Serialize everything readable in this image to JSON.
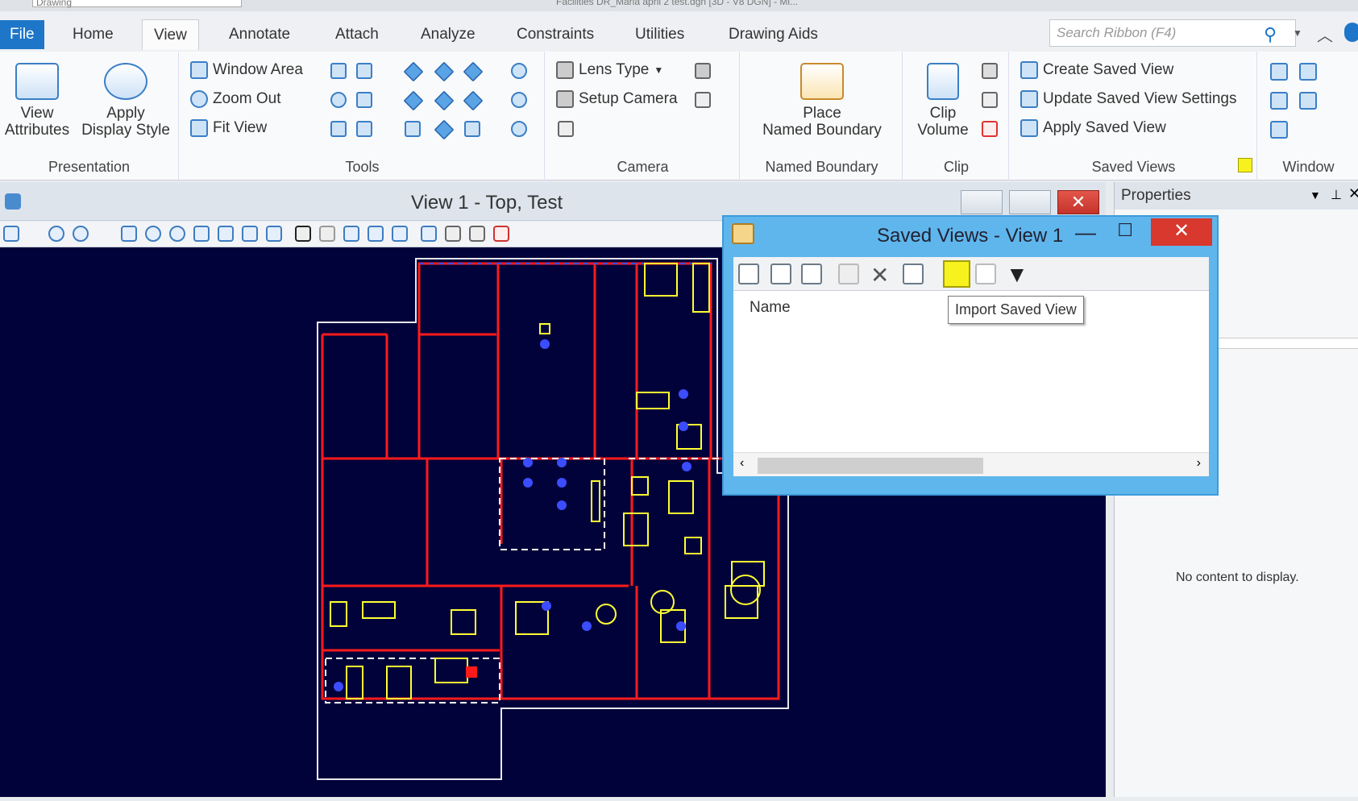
{
  "app": {
    "workspace": "Drawing",
    "title": "Facilities DR_Maria april 2 test.dgn [3D - V8 DGN] - Mi..."
  },
  "tabs": [
    "File",
    "Home",
    "View",
    "Annotate",
    "Attach",
    "Analyze",
    "Constraints",
    "Utilities",
    "Drawing Aids"
  ],
  "active_tab": "View",
  "search": {
    "placeholder": "Search Ribbon (F4)"
  },
  "ribbon": {
    "presentation": {
      "label": "Presentation",
      "view_attributes": "View\nAttributes",
      "apply_display_style": "Apply\nDisplay Style"
    },
    "tools": {
      "label": "Tools",
      "window_area": "Window Area",
      "zoom_out": "Zoom Out",
      "fit_view": "Fit View"
    },
    "camera": {
      "label": "Camera",
      "lens_type": "Lens Type",
      "setup_camera": "Setup Camera"
    },
    "named_boundary": {
      "label": "Named Boundary",
      "place": "Place\nNamed Boundary"
    },
    "clip": {
      "label": "Clip",
      "clip_volume": "Clip\nVolume"
    },
    "saved_views": {
      "label": "Saved Views",
      "create": "Create Saved View",
      "update": "Update Saved View Settings",
      "apply": "Apply Saved View"
    },
    "window": {
      "label": "Window"
    }
  },
  "view": {
    "title": "View 1 - Top, Test"
  },
  "properties": {
    "title": "Properties",
    "empty": "No content to display."
  },
  "dialog": {
    "title": "Saved Views - View 1",
    "column_name": "Name",
    "tooltip": "Import Saved View"
  },
  "colors": {
    "canvas": "#02023a",
    "wall": "#ff1a1a",
    "furniture": "#ffff33",
    "accent": "#1e76c9"
  }
}
